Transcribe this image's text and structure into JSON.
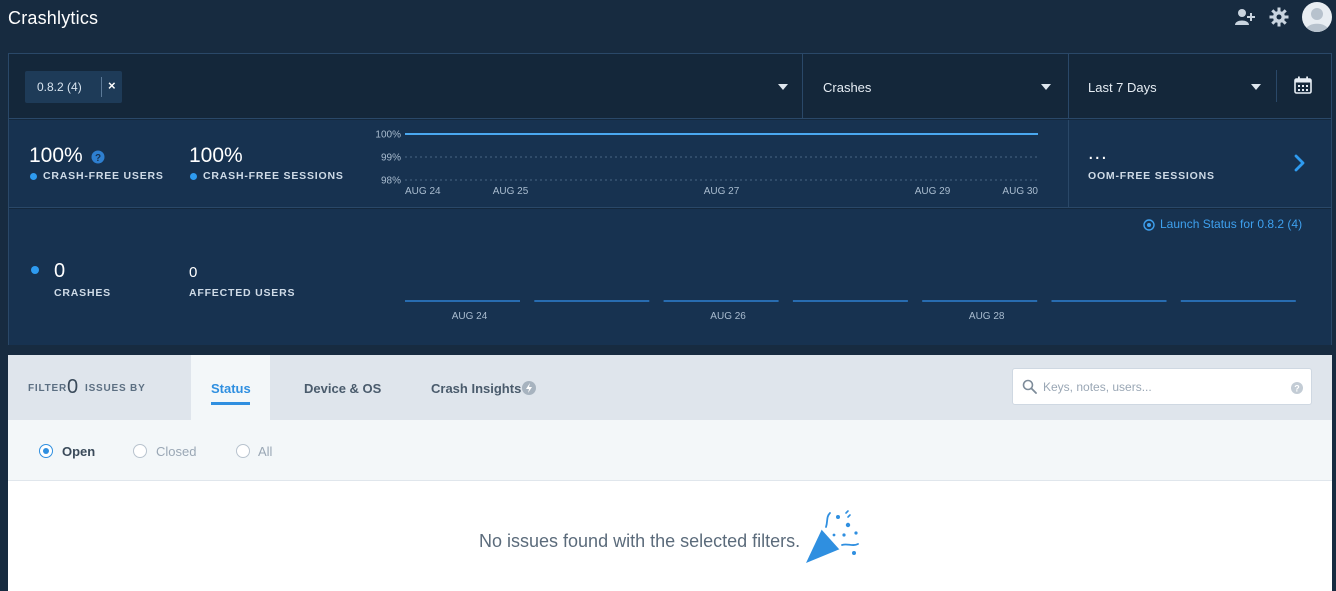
{
  "app": {
    "title": "Crashlytics"
  },
  "header_icons": [
    "add-user-icon",
    "gear-icon",
    "avatar"
  ],
  "filters": {
    "version_chip": "0.8.2 (4)",
    "chip_remove": "×",
    "event_type": "Crashes",
    "date_range": "Last 7 Days"
  },
  "metrics": {
    "crash_free_users": {
      "value": "100%",
      "label": "CRASH-FREE USERS"
    },
    "crash_free_sessions": {
      "value": "100%",
      "label": "CRASH-FREE SESSIONS"
    },
    "oom_free_sessions": {
      "value": "...",
      "label": "OOM-FREE SESSIONS"
    }
  },
  "crash_stats": {
    "crashes": {
      "value": "0",
      "label": "CRASHES"
    },
    "affected_users": {
      "value": "0",
      "label": "AFFECTED USERS"
    },
    "launch_status": "Launch Status for 0.8.2 (4)"
  },
  "issues": {
    "filter_prefix": "FILTER",
    "filter_count": "0",
    "filter_suffix": "ISSUES BY",
    "tabs": [
      {
        "label": "Status",
        "active": true
      },
      {
        "label": "Device & OS",
        "active": false
      },
      {
        "label": "Crash Insights",
        "active": false
      }
    ],
    "search_placeholder": "Keys, notes, users...",
    "status_options": [
      {
        "label": "Open",
        "selected": true
      },
      {
        "label": "Closed",
        "selected": false
      },
      {
        "label": "All",
        "selected": false
      }
    ],
    "empty_message": "No issues found with the selected filters."
  },
  "colors": {
    "accent": "#2e9bf0",
    "panel_bg": "#173250",
    "page_bg": "#172b40"
  },
  "chart_data": [
    {
      "type": "line",
      "title": "",
      "x": [
        "AUG 24",
        "AUG 25",
        "AUG 26",
        "AUG 27",
        "AUG 28",
        "AUG 29",
        "AUG 30"
      ],
      "x_tick_labels": [
        "AUG 24",
        "AUG 25",
        "AUG 27",
        "AUG 29",
        "AUG 30"
      ],
      "y_tick_labels": [
        "100%",
        "99%",
        "98%"
      ],
      "ylim": [
        98,
        100
      ],
      "series": [
        {
          "values": [
            100,
            100,
            100,
            100,
            100,
            100,
            100
          ]
        }
      ],
      "grid": true
    },
    {
      "type": "bar",
      "title": "",
      "categories": [
        "AUG 24",
        "AUG 25",
        "AUG 26",
        "AUG 27",
        "AUG 28",
        "AUG 29",
        "AUG 30"
      ],
      "x_tick_labels": [
        "AUG 24",
        "AUG 26",
        "AUG 28"
      ],
      "values": [
        0,
        0,
        0,
        0,
        0,
        0,
        0
      ]
    }
  ]
}
